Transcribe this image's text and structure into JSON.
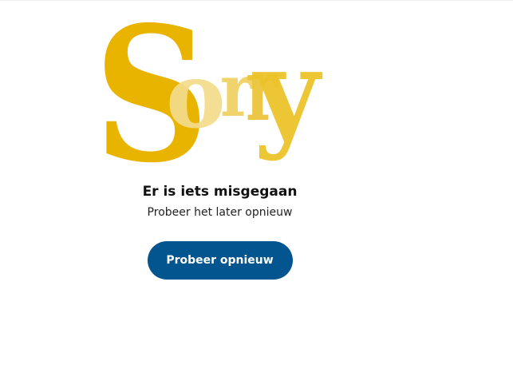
{
  "hero": {
    "letters": [
      "S",
      "o",
      "r",
      "r",
      "y"
    ]
  },
  "error": {
    "title": "Er is iets misgegaan",
    "subtitle": "Probeer het later opnieuw"
  },
  "actions": {
    "retry_label": "Probeer opnieuw"
  },
  "colors": {
    "brand_yellow": "#e8b400",
    "button_blue": "#03558f",
    "text": "#111111",
    "background": "#ffffff"
  }
}
